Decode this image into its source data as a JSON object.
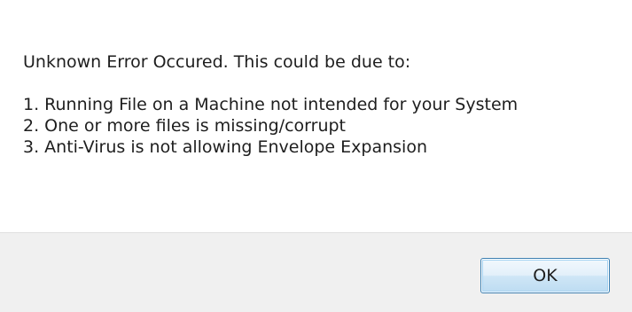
{
  "dialog": {
    "intro": "Unknown Error Occured. This could be due to:",
    "reasons": [
      "1. Running File on a Machine not intended for your System",
      "2. One or more files is missing/corrupt",
      "3. Anti-Virus is not allowing Envelope Expansion"
    ],
    "ok_label": "OK"
  }
}
